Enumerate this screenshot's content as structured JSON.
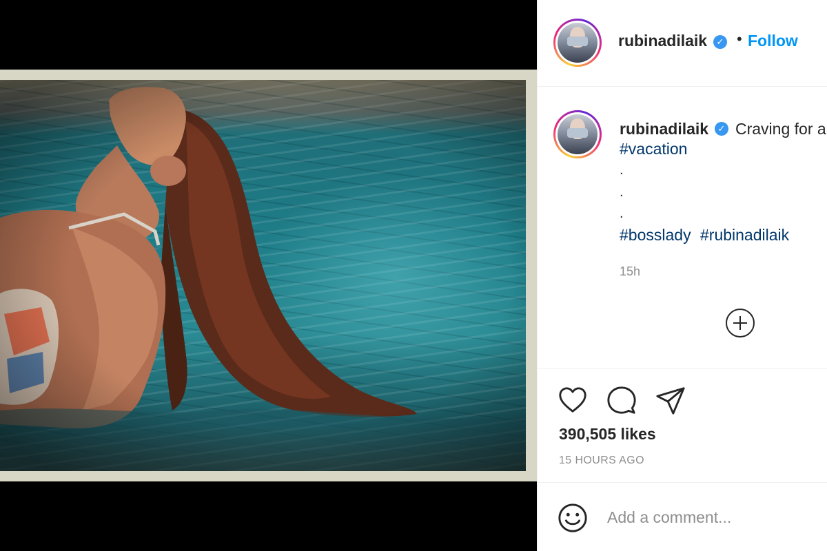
{
  "post": {
    "username": "rubinadilaik",
    "verified_glyph": "✓",
    "follow_separator": "•",
    "follow_label": "Follow"
  },
  "caption": {
    "text": "Craving for a",
    "hashtags_line1": [
      "#vacation"
    ],
    "dots": [
      ".",
      ".",
      "."
    ],
    "hashtags_line2": [
      "#bosslady",
      "#rubinadilaik"
    ],
    "time": "15h"
  },
  "engagement": {
    "likes": "390,505 likes",
    "date": "15 HOURS AGO"
  },
  "comment_box": {
    "placeholder": "Add a comment..."
  },
  "icons": {
    "like": "heart-icon",
    "comment": "comment-bubble-icon",
    "share": "paper-plane-icon",
    "emoji": "smiley-icon",
    "load_more": "plus-circle-icon"
  },
  "colors": {
    "accent": "#0095f6",
    "hashtag": "#00376b",
    "muted": "#8e8e8e",
    "verified": "#3897f0"
  }
}
